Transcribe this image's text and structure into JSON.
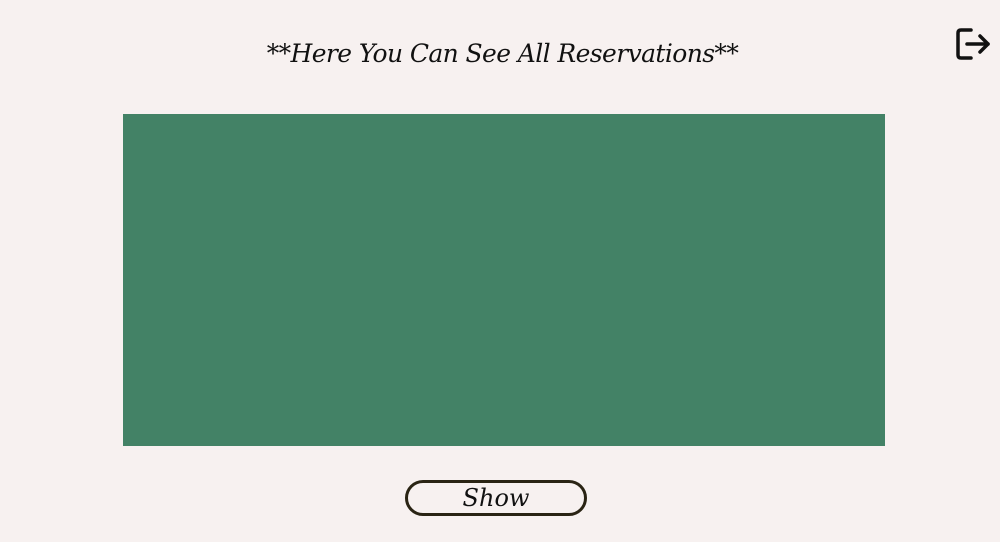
{
  "header": {
    "title": "**Here You Can See All Reservations**",
    "logout_icon": "logout-icon"
  },
  "reservations_panel": {
    "background_color": "#438266"
  },
  "actions": {
    "show_label": "Show"
  },
  "colors": {
    "page_background": "#f7f1f0",
    "panel": "#438266",
    "button_border": "#2a2414",
    "text": "#111111"
  }
}
